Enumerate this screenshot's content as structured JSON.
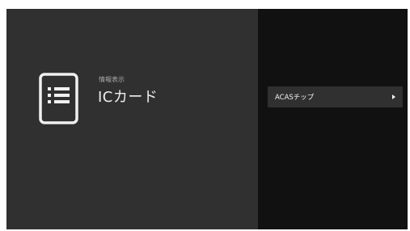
{
  "header": {
    "subtitle": "情報表示",
    "title": "ICカード",
    "icon": "document-list-icon"
  },
  "menu": {
    "items": [
      {
        "label": "ACASチップ",
        "icon": "chevron-right-icon"
      }
    ]
  }
}
